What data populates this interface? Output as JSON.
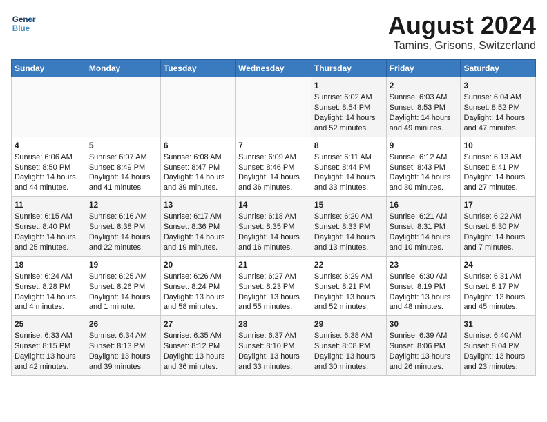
{
  "header": {
    "logo_line1": "General",
    "logo_line2": "Blue",
    "main_title": "August 2024",
    "subtitle": "Tamins, Grisons, Switzerland"
  },
  "days_of_week": [
    "Sunday",
    "Monday",
    "Tuesday",
    "Wednesday",
    "Thursday",
    "Friday",
    "Saturday"
  ],
  "weeks": [
    {
      "cells": [
        {
          "empty": true
        },
        {
          "empty": true
        },
        {
          "empty": true
        },
        {
          "empty": true
        },
        {
          "day": 1,
          "sunrise": "6:02 AM",
          "sunset": "8:54 PM",
          "daylight": "14 hours and 52 minutes."
        },
        {
          "day": 2,
          "sunrise": "6:03 AM",
          "sunset": "8:53 PM",
          "daylight": "14 hours and 49 minutes."
        },
        {
          "day": 3,
          "sunrise": "6:04 AM",
          "sunset": "8:52 PM",
          "daylight": "14 hours and 47 minutes."
        }
      ]
    },
    {
      "cells": [
        {
          "day": 4,
          "sunrise": "6:06 AM",
          "sunset": "8:50 PM",
          "daylight": "14 hours and 44 minutes."
        },
        {
          "day": 5,
          "sunrise": "6:07 AM",
          "sunset": "8:49 PM",
          "daylight": "14 hours and 41 minutes."
        },
        {
          "day": 6,
          "sunrise": "6:08 AM",
          "sunset": "8:47 PM",
          "daylight": "14 hours and 39 minutes."
        },
        {
          "day": 7,
          "sunrise": "6:09 AM",
          "sunset": "8:46 PM",
          "daylight": "14 hours and 36 minutes."
        },
        {
          "day": 8,
          "sunrise": "6:11 AM",
          "sunset": "8:44 PM",
          "daylight": "14 hours and 33 minutes."
        },
        {
          "day": 9,
          "sunrise": "6:12 AM",
          "sunset": "8:43 PM",
          "daylight": "14 hours and 30 minutes."
        },
        {
          "day": 10,
          "sunrise": "6:13 AM",
          "sunset": "8:41 PM",
          "daylight": "14 hours and 27 minutes."
        }
      ]
    },
    {
      "cells": [
        {
          "day": 11,
          "sunrise": "6:15 AM",
          "sunset": "8:40 PM",
          "daylight": "14 hours and 25 minutes."
        },
        {
          "day": 12,
          "sunrise": "6:16 AM",
          "sunset": "8:38 PM",
          "daylight": "14 hours and 22 minutes."
        },
        {
          "day": 13,
          "sunrise": "6:17 AM",
          "sunset": "8:36 PM",
          "daylight": "14 hours and 19 minutes."
        },
        {
          "day": 14,
          "sunrise": "6:18 AM",
          "sunset": "8:35 PM",
          "daylight": "14 hours and 16 minutes."
        },
        {
          "day": 15,
          "sunrise": "6:20 AM",
          "sunset": "8:33 PM",
          "daylight": "14 hours and 13 minutes."
        },
        {
          "day": 16,
          "sunrise": "6:21 AM",
          "sunset": "8:31 PM",
          "daylight": "14 hours and 10 minutes."
        },
        {
          "day": 17,
          "sunrise": "6:22 AM",
          "sunset": "8:30 PM",
          "daylight": "14 hours and 7 minutes."
        }
      ]
    },
    {
      "cells": [
        {
          "day": 18,
          "sunrise": "6:24 AM",
          "sunset": "8:28 PM",
          "daylight": "14 hours and 4 minutes."
        },
        {
          "day": 19,
          "sunrise": "6:25 AM",
          "sunset": "8:26 PM",
          "daylight": "14 hours and 1 minute."
        },
        {
          "day": 20,
          "sunrise": "6:26 AM",
          "sunset": "8:24 PM",
          "daylight": "13 hours and 58 minutes."
        },
        {
          "day": 21,
          "sunrise": "6:27 AM",
          "sunset": "8:23 PM",
          "daylight": "13 hours and 55 minutes."
        },
        {
          "day": 22,
          "sunrise": "6:29 AM",
          "sunset": "8:21 PM",
          "daylight": "13 hours and 52 minutes."
        },
        {
          "day": 23,
          "sunrise": "6:30 AM",
          "sunset": "8:19 PM",
          "daylight": "13 hours and 48 minutes."
        },
        {
          "day": 24,
          "sunrise": "6:31 AM",
          "sunset": "8:17 PM",
          "daylight": "13 hours and 45 minutes."
        }
      ]
    },
    {
      "cells": [
        {
          "day": 25,
          "sunrise": "6:33 AM",
          "sunset": "8:15 PM",
          "daylight": "13 hours and 42 minutes."
        },
        {
          "day": 26,
          "sunrise": "6:34 AM",
          "sunset": "8:13 PM",
          "daylight": "13 hours and 39 minutes."
        },
        {
          "day": 27,
          "sunrise": "6:35 AM",
          "sunset": "8:12 PM",
          "daylight": "13 hours and 36 minutes."
        },
        {
          "day": 28,
          "sunrise": "6:37 AM",
          "sunset": "8:10 PM",
          "daylight": "13 hours and 33 minutes."
        },
        {
          "day": 29,
          "sunrise": "6:38 AM",
          "sunset": "8:08 PM",
          "daylight": "13 hours and 30 minutes."
        },
        {
          "day": 30,
          "sunrise": "6:39 AM",
          "sunset": "8:06 PM",
          "daylight": "13 hours and 26 minutes."
        },
        {
          "day": 31,
          "sunrise": "6:40 AM",
          "sunset": "8:04 PM",
          "daylight": "13 hours and 23 minutes."
        }
      ]
    }
  ]
}
